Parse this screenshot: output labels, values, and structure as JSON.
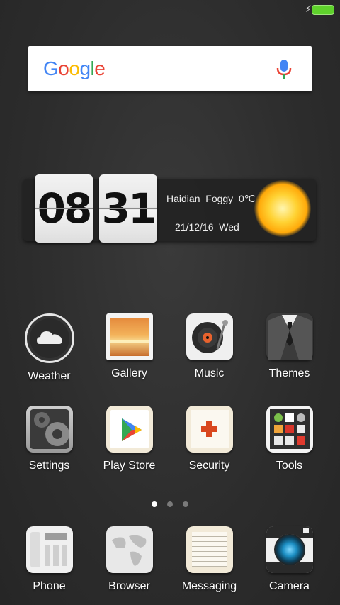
{
  "status_bar": {
    "charging_icon": "bolt-icon",
    "battery_color": "#5fd22c"
  },
  "search_widget": {
    "logo": "Google",
    "logo_colors": [
      "#4285F4",
      "#EA4335",
      "#FBBC05",
      "#4285F4",
      "#34A853",
      "#EA4335"
    ],
    "mic_icon": "mic-icon"
  },
  "clock_widget": {
    "hours": "08",
    "minutes": "31",
    "location": "Haidian",
    "condition": "Foggy",
    "temperature": "0℃",
    "date": "21/12/16",
    "weekday": "Wed",
    "weather_icon": "sun-icon"
  },
  "apps_row1": [
    {
      "label": "Weather",
      "icon": "weather-icon"
    },
    {
      "label": "Gallery",
      "icon": "gallery-icon"
    },
    {
      "label": "Music",
      "icon": "music-icon"
    },
    {
      "label": "Themes",
      "icon": "themes-icon"
    }
  ],
  "apps_row2": [
    {
      "label": "Settings",
      "icon": "settings-icon"
    },
    {
      "label": "Play Store",
      "icon": "play-store-icon"
    },
    {
      "label": "Security",
      "icon": "security-icon"
    },
    {
      "label": "Tools",
      "icon": "tools-icon"
    }
  ],
  "page_indicator": {
    "pages": 3,
    "active": 1
  },
  "dock": [
    {
      "label": "Phone",
      "icon": "phone-icon"
    },
    {
      "label": "Browser",
      "icon": "browser-icon"
    },
    {
      "label": "Messaging",
      "icon": "messaging-icon"
    },
    {
      "label": "Camera",
      "icon": "camera-icon"
    }
  ]
}
